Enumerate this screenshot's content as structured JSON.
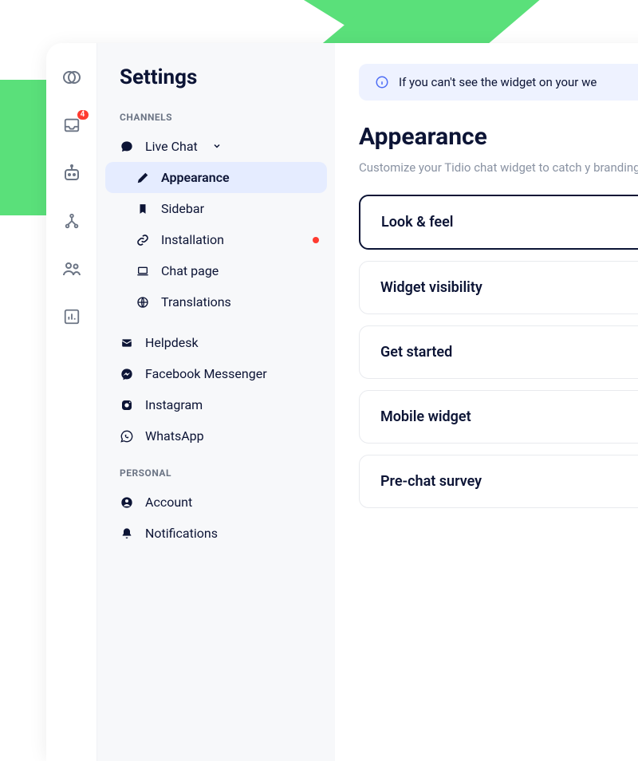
{
  "rail": {
    "inbox_badge": "4"
  },
  "sidebar": {
    "title": "Settings",
    "sections": {
      "channels_label": "CHANNELS",
      "personal_label": "PERSONAL"
    },
    "items": {
      "live_chat": "Live Chat",
      "appearance": "Appearance",
      "sidebar": "Sidebar",
      "installation": "Installation",
      "chat_page": "Chat page",
      "translations": "Translations",
      "helpdesk": "Helpdesk",
      "fb_messenger": "Facebook Messenger",
      "instagram": "Instagram",
      "whatsapp": "WhatsApp",
      "account": "Account",
      "notifications": "Notifications"
    }
  },
  "main": {
    "banner": "If you can't see the widget on your we",
    "title": "Appearance",
    "description": "Customize your Tidio chat widget to catch y branding.",
    "cards": {
      "look": "Look & feel",
      "visibility": "Widget visibility",
      "get_started": "Get started",
      "mobile": "Mobile widget",
      "prechat": "Pre-chat survey"
    }
  }
}
